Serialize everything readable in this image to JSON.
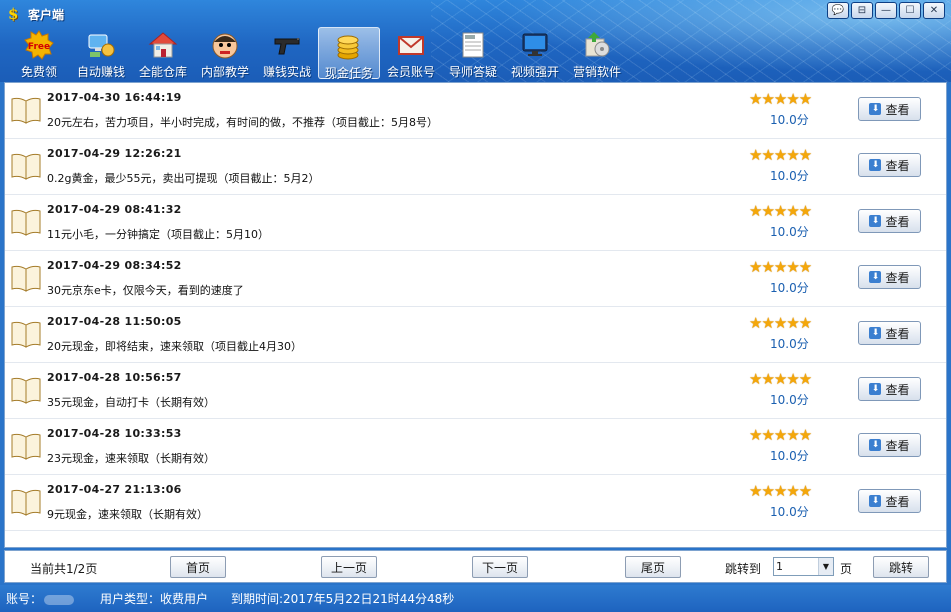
{
  "window": {
    "title": "客户端",
    "controls": [
      "💬",
      "⊟",
      "—",
      "☐",
      "✕"
    ]
  },
  "toolbar": {
    "items": [
      {
        "label": "免费领",
        "icon": "free-badge-icon"
      },
      {
        "label": "自动赚钱",
        "icon": "computer-money-icon"
      },
      {
        "label": "全能仓库",
        "icon": "house-icon"
      },
      {
        "label": "内部教学",
        "icon": "face-icon"
      },
      {
        "label": "赚钱实战",
        "icon": "gun-icon"
      },
      {
        "label": "现金任务",
        "icon": "coins-icon",
        "active": true
      },
      {
        "label": "会员账号",
        "icon": "envelope-icon"
      },
      {
        "label": "导师答疑",
        "icon": "newspaper-icon"
      },
      {
        "label": "视频强开",
        "icon": "monitor-icon"
      },
      {
        "label": "营销软件",
        "icon": "software-box-icon"
      }
    ]
  },
  "tasks": [
    {
      "date": "2017-04-30 16:44:19",
      "desc": "20元左右，苦力项目，半小时完成，有时间的做，不推荐（项目截止：5月8号）",
      "stars": "★★★★★",
      "score": "10.0分",
      "button": "查看"
    },
    {
      "date": "2017-04-29 12:26:21",
      "desc": "0.2g黄金，最少55元，卖出可提现（项目截止：5月2）",
      "stars": "★★★★★",
      "score": "10.0分",
      "button": "查看"
    },
    {
      "date": "2017-04-29 08:41:32",
      "desc": "11元小毛，一分钟搞定（项目截止：5月10）",
      "stars": "★★★★★",
      "score": "10.0分",
      "button": "查看"
    },
    {
      "date": "2017-04-29 08:34:52",
      "desc": "30元京东e卡，仅限今天，看到的速度了",
      "stars": "★★★★★",
      "score": "10.0分",
      "button": "查看"
    },
    {
      "date": "2017-04-28 11:50:05",
      "desc": "20元现金，即将结束，速来领取（项目截止4月30）",
      "stars": "★★★★★",
      "score": "10.0分",
      "button": "查看"
    },
    {
      "date": "2017-04-28 10:56:57",
      "desc": "35元现金，自动打卡（长期有效）",
      "stars": "★★★★★",
      "score": "10.0分",
      "button": "查看"
    },
    {
      "date": "2017-04-28 10:33:53",
      "desc": "23元现金，速来领取（长期有效）",
      "stars": "★★★★★",
      "score": "10.0分",
      "button": "查看"
    },
    {
      "date": "2017-04-27 21:13:06",
      "desc": "9元现金，速来领取（长期有效）",
      "stars": "★★★★★",
      "score": "10.0分",
      "button": "查看"
    }
  ],
  "pager": {
    "info": "当前共1/2页",
    "first": "首页",
    "prev": "上一页",
    "next": "下一页",
    "last": "尾页",
    "jump_label": "跳转到",
    "jump_value": "1",
    "page_unit": "页",
    "jump_button": "跳转"
  },
  "status": {
    "account_label": "账号：",
    "user_type": "用户类型：收费用户",
    "expiry": "到期时间:2017年5月22日21时44分48秒"
  },
  "colors": {
    "accent": "#1f66c2",
    "star": "#f4a70a",
    "score": "#1a5fb0"
  }
}
